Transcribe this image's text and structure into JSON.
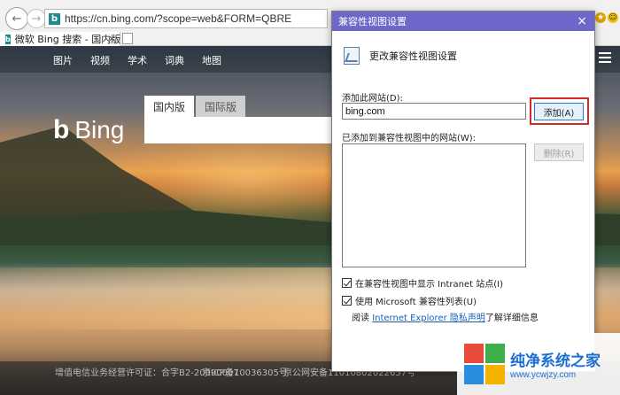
{
  "browser": {
    "address": "https://cn.bing.com/?scope=web&FORM=QBRE",
    "tab_title": "微软 Bing 搜索 - 国内版",
    "tab_close": "×"
  },
  "page": {
    "nav": [
      "图片",
      "视频",
      "学术",
      "词典",
      "地图"
    ],
    "logo_text": "Bing",
    "search_tabs": [
      "国内版",
      "国际版"
    ],
    "footer": [
      "增值电信业务经营许可证：合字B2-20090007",
      "京ICP备10036305号",
      "京公网安备11010802022657号"
    ]
  },
  "dialog": {
    "title": "兼容性视图设置",
    "close": "×",
    "heading": "更改兼容性视图设置",
    "add_label": "添加此网站(D):",
    "site_value": "bing.com",
    "add_button": "添加(A)",
    "list_label": "已添加到兼容性视图中的网站(W):",
    "remove_button": "删除(R)",
    "checkbox1": "在兼容性视图中显示 Intranet 站点(I)",
    "checkbox1_checked": true,
    "checkbox2": "使用 Microsoft 兼容性列表(U)",
    "checkbox2_checked": true,
    "read_prefix": "阅读",
    "read_link": "Internet Explorer 隐私声明",
    "read_suffix": "了解详细信息"
  },
  "watermark": {
    "name": "纯净系统之家",
    "url": "www.ycwjzy.com"
  },
  "colors": {
    "dialog_title_bg": "#6c67c9",
    "highlight": "#d42a2a",
    "link": "#1a5fb4"
  }
}
